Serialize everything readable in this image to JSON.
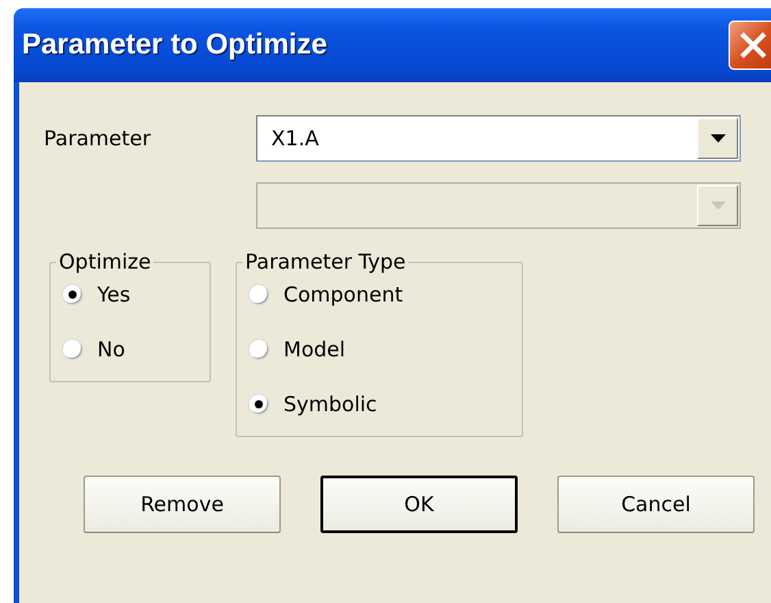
{
  "window": {
    "title": "Parameter to Optimize"
  },
  "combos": [
    {
      "label": "Parameter",
      "value": "X1.A",
      "disabled": false
    },
    {
      "disabled": true
    }
  ],
  "groups": [
    {
      "title": "Optimize",
      "options": [
        {
          "label": "Yes",
          "selected": true
        },
        {
          "label": "No",
          "selected": false
        }
      ]
    },
    {
      "title": "Parameter Type",
      "options": [
        {
          "label": "Component",
          "selected": false
        },
        {
          "label": "Model",
          "selected": false
        },
        {
          "label": "Symbolic",
          "selected": true
        }
      ]
    }
  ],
  "buttons": [
    {
      "label": "Remove",
      "default": false
    },
    {
      "label": "OK",
      "default": true
    },
    {
      "label": "Cancel",
      "default": false
    }
  ]
}
